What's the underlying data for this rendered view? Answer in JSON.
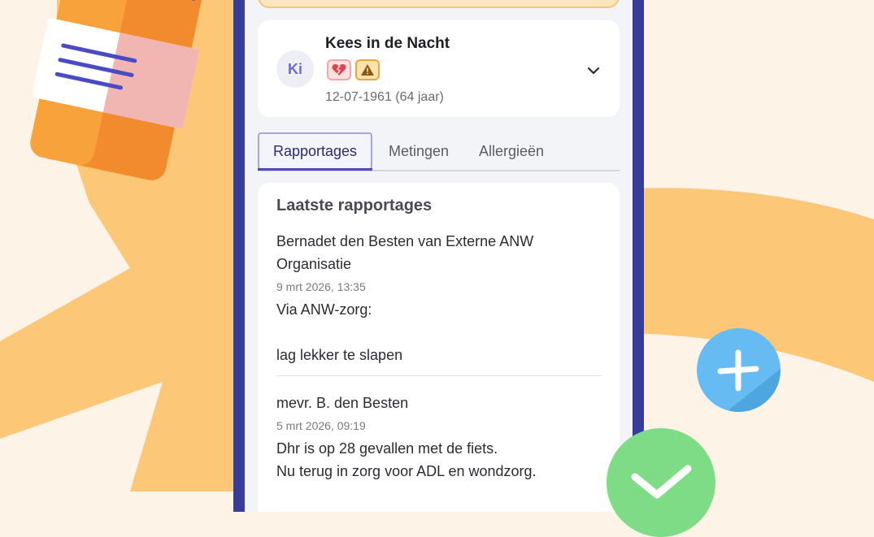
{
  "patient": {
    "initials": "Ki",
    "name": "Kees in de Nacht",
    "birthdate": "12-07-1961 (64 jaar)",
    "badges": [
      {
        "icon": "broken-heart-icon",
        "color": "#E0454F"
      },
      {
        "icon": "warning-icon",
        "color": "#8A5A10"
      }
    ]
  },
  "tabs": [
    {
      "label": "Rapportages",
      "active": true
    },
    {
      "label": "Metingen",
      "active": false
    },
    {
      "label": "Allergieën",
      "active": false
    }
  ],
  "reports": {
    "title": "Laatste rapportages",
    "entries": [
      {
        "author": "Bernadet den Besten van Externe ANW Organisatie",
        "date": "9 mrt 2026, 13:35",
        "body": "Via ANW-zorg:\n\nlag lekker te slapen"
      },
      {
        "author": "mevr. B. den Besten",
        "date": "5 mrt 2026, 09:19",
        "body": "Dhr is op 28 gevallen met de fiets.\nNu terug in zorg voor ADL en wondzorg."
      }
    ]
  },
  "colors": {
    "accent": "#4C49C2",
    "phone_frame": "#363C9A",
    "background": "#FDF3E7",
    "decor_orange": "#FCC878"
  }
}
